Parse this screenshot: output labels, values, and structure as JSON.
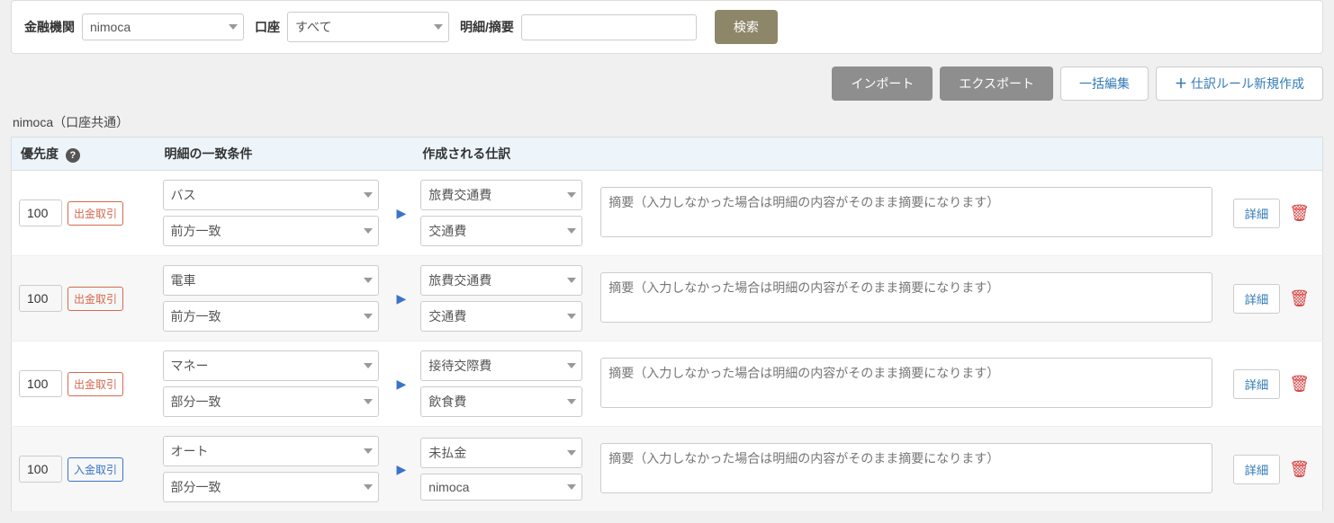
{
  "filter": {
    "institution_label": "金融機関",
    "institution_value": "nimoca",
    "account_label": "口座",
    "account_value": "すべて",
    "detail_summary_label": "明細/摘要",
    "detail_summary_value": "",
    "search_button": "検索"
  },
  "actions": {
    "import": "インポート",
    "export": "エクスポート",
    "bulk_edit": "一括編集",
    "new_rule": "仕訳ルール新規作成"
  },
  "section_heading": "nimoca（口座共通）",
  "table_headers": {
    "priority": "優先度",
    "conditions": "明細の一致条件",
    "journal": "作成される仕訳"
  },
  "common": {
    "detail_button": "詳細",
    "summary_placeholder": "摘要（入力しなかった場合は明細の内容がそのまま摘要になります）"
  },
  "rows": [
    {
      "priority": "100",
      "direction": "出金取引",
      "direction_type": "out",
      "keyword": "バス",
      "match_type": "前方一致",
      "cat1": "旅費交通費",
      "cat2": "交通費"
    },
    {
      "priority": "100",
      "direction": "出金取引",
      "direction_type": "out",
      "keyword": "電車",
      "match_type": "前方一致",
      "cat1": "旅費交通費",
      "cat2": "交通費"
    },
    {
      "priority": "100",
      "direction": "出金取引",
      "direction_type": "out",
      "keyword": "マネー",
      "match_type": "部分一致",
      "cat1": "接待交際費",
      "cat2": "飲食費"
    },
    {
      "priority": "100",
      "direction": "入金取引",
      "direction_type": "in",
      "keyword": "オート",
      "match_type": "部分一致",
      "cat1": "未払金",
      "cat2": "nimoca"
    }
  ]
}
